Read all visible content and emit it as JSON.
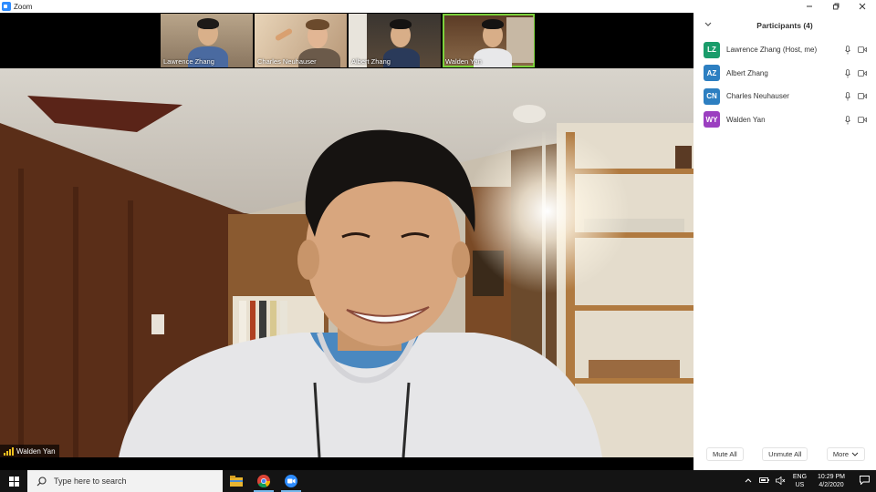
{
  "window": {
    "title": "Zoom"
  },
  "thumbnails": [
    {
      "name": "Lawrence Zhang"
    },
    {
      "name": "Charles Neuhauser"
    },
    {
      "name": "Albert Zhang"
    },
    {
      "name": "Walden Yan"
    }
  ],
  "active_speaker": {
    "name": "Walden Yan"
  },
  "participants_panel": {
    "title": "Participants (4)",
    "participants": [
      {
        "initials": "LZ",
        "name": "Lawrence Zhang (Host, me)",
        "color": "#1a9c6b"
      },
      {
        "initials": "AZ",
        "name": "Albert Zhang",
        "color": "#2d7fc1"
      },
      {
        "initials": "CN",
        "name": "Charles Neuhauser",
        "color": "#2d7fc1"
      },
      {
        "initials": "WY",
        "name": "Walden Yan",
        "color": "#9b3fc0"
      }
    ],
    "buttons": {
      "mute_all": "Mute All",
      "unmute_all": "Unmute All",
      "more": "More"
    }
  },
  "taskbar": {
    "search_placeholder": "Type here to search",
    "lang_line1": "ENG",
    "lang_line2": "US",
    "time": "10:29 PM",
    "date": "4/2/2020"
  },
  "colors": {
    "accent": "#2d8cff",
    "active_border": "#7bd13b",
    "taskbar": "#141414"
  },
  "icons": [
    "zoom-app-icon",
    "minimize-icon",
    "restore-icon",
    "close-icon",
    "chevron-down-icon",
    "mic-icon",
    "camera-icon",
    "windows-start-icon",
    "search-icon",
    "file-explorer-icon",
    "chrome-icon",
    "zoom-taskbar-icon",
    "tray-chevron-icon",
    "network-icon",
    "volume-icon",
    "notification-icon"
  ]
}
